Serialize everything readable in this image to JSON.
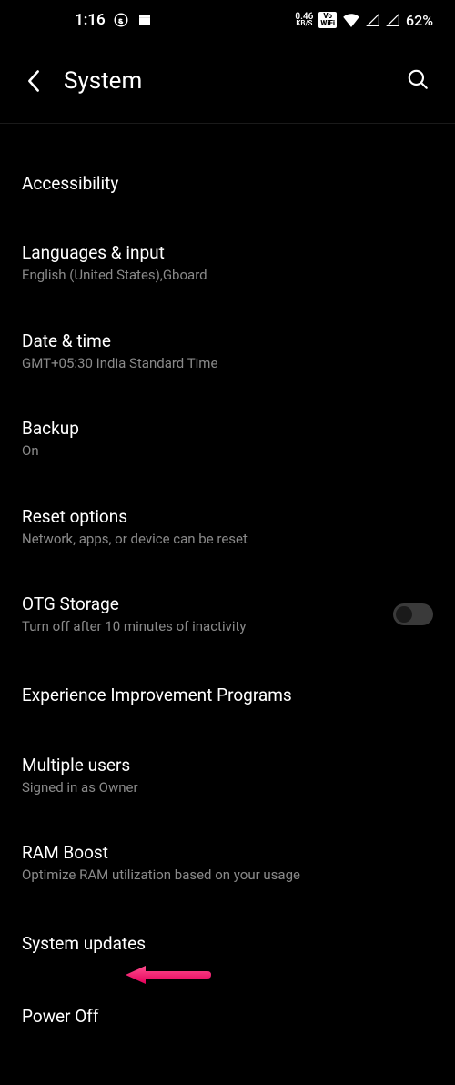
{
  "status": {
    "time": "1:16",
    "kbs_value": "0.46",
    "kbs_label": "KB/S",
    "vowifi_top": "Vo",
    "vowifi_bot": "WiFi",
    "battery": "62%"
  },
  "header": {
    "title": "System"
  },
  "items": [
    {
      "title": "Accessibility",
      "sub": ""
    },
    {
      "title": "Languages & input",
      "sub": "English (United States),Gboard"
    },
    {
      "title": "Date & time",
      "sub": "GMT+05:30 India Standard Time"
    },
    {
      "title": "Backup",
      "sub": "On"
    },
    {
      "title": "Reset options",
      "sub": "Network, apps, or device can be reset"
    },
    {
      "title": "OTG Storage",
      "sub": "Turn off after 10 minutes of inactivity",
      "toggle": false
    },
    {
      "title": "Experience Improvement Programs",
      "sub": ""
    },
    {
      "title": "Multiple users",
      "sub": "Signed in as Owner"
    },
    {
      "title": "RAM Boost",
      "sub": "Optimize RAM utilization based on your usage"
    },
    {
      "title": "System updates",
      "sub": ""
    },
    {
      "title": "Power Off",
      "sub": ""
    }
  ],
  "annotation": {
    "color": "#ff2e74"
  }
}
